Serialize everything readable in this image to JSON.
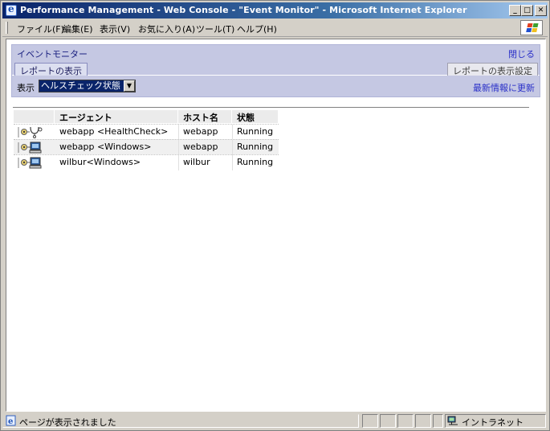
{
  "window": {
    "title": "Performance Management - Web Console - \"Event Monitor\" - Microsoft Internet Explorer",
    "min_label": "_",
    "max_label": "□",
    "close_label": "✕"
  },
  "menu": {
    "items": [
      "ファイル(F)",
      "編集(E)",
      "表示(V)",
      "お気に入り(A)",
      "ツール(T)",
      "ヘルプ(H)"
    ]
  },
  "panel": {
    "title": "イベントモニター",
    "close_link": "閉じる",
    "active_tab": "レポートの表示",
    "settings_tab": "レポートの表示設定",
    "display_label": "表示",
    "display_select_value": "ヘルスチェック状態",
    "refresh_link": "最新情報に更新"
  },
  "table": {
    "headers": [
      "エージェント",
      "ホスト名",
      "状態"
    ],
    "rows": [
      {
        "icon": "healthcheck-agent-icon",
        "agent": "webapp <HealthCheck>",
        "host": "webapp",
        "status": "Running"
      },
      {
        "icon": "windows-agent-icon",
        "agent": "webapp <Windows>",
        "host": "webapp",
        "status": "Running"
      },
      {
        "icon": "windows-agent-icon",
        "agent": "wilbur<Windows>",
        "host": "wilbur",
        "status": "Running"
      }
    ]
  },
  "status": {
    "message": "ページが表示されました",
    "zone": "イントラネット"
  },
  "colors": {
    "titlebar": "#0a246a",
    "panel": "#c5c8e3",
    "link": "#2a30c8"
  }
}
